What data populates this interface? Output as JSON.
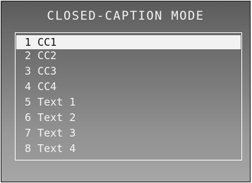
{
  "menu": {
    "title": "CLOSED-CAPTION MODE",
    "selected_index": 0,
    "options": [
      {
        "label": "1 CC1"
      },
      {
        "label": "2 CC2"
      },
      {
        "label": "3 CC3"
      },
      {
        "label": "4 CC4"
      },
      {
        "label": "5 Text 1"
      },
      {
        "label": "6 Text 2"
      },
      {
        "label": "7 Text 3"
      },
      {
        "label": "8 Text 4"
      }
    ]
  },
  "colors": {
    "highlight": "#f2f2f2",
    "text": "#f4f4f4",
    "selected_text": "#111111"
  }
}
